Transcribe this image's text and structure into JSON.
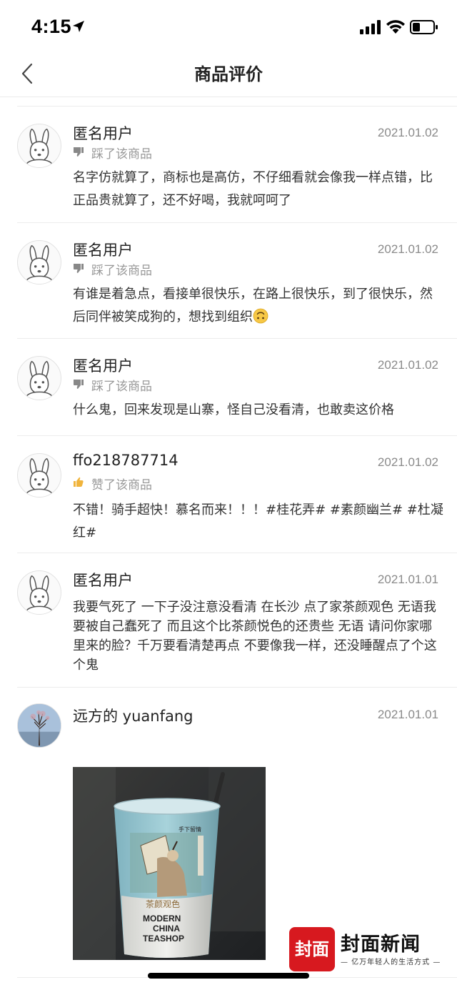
{
  "status_bar": {
    "time": "4:15"
  },
  "nav": {
    "title": "商品评价"
  },
  "reviews": [
    {
      "user": "匿名用户",
      "date": "2021.01.02",
      "rating_icon": "thumbs-down-icon",
      "rating_label": "踩了该商品",
      "content": "名字仿就算了，商标也是高仿，不仔细看就会像我一样点错，比正品贵就算了，还不好喝，我就呵呵了"
    },
    {
      "user": "匿名用户",
      "date": "2021.01.02",
      "rating_icon": "thumbs-down-icon",
      "rating_label": "踩了该商品",
      "content": "有谁是着急点，看接单很快乐，在路上很快乐，到了很快乐，然后同伴被笑成狗的，想找到组织"
    },
    {
      "user": "匿名用户",
      "date": "2021.01.02",
      "rating_icon": "thumbs-down-icon",
      "rating_label": "踩了该商品",
      "content": "什么鬼，回来发现是山寨，怪自己没看清，也敢卖这价格"
    },
    {
      "user": "ffo218787714",
      "date": "2021.01.02",
      "rating_icon": "thumbs-up-icon",
      "rating_label": "赞了该商品",
      "content": "不错！骑手超快！慕名而来！！！#桂花弄# #素颜幽兰# #杜凝红#"
    },
    {
      "user": "匿名用户",
      "date": "2021.01.01",
      "rating_icon": "",
      "rating_label": "",
      "content": "我要气死了 一下子没注意没看清 在长沙 点了家茶颜观色 无语我要被自己蠢死了 而且这个比茶颜悦色的还贵些 无语 请问你家哪里来的脸？千万要看清楚再点 不要像我一样，还没睡醒点了个这个鬼"
    },
    {
      "user": "远方的 yuanfang",
      "date": "2021.01.01",
      "rating_icon": "",
      "rating_label": "",
      "content": ""
    }
  ],
  "photo": {
    "cup_brand": "茶颜观色",
    "cup_text_line1": "MODERN",
    "cup_text_line2": "CHINA",
    "cup_text_line3": "TEASHOP"
  },
  "watermark": {
    "badge": "封面",
    "name": "封面新闻",
    "slogan": "— 亿万年轻人的生活方式 —"
  },
  "colors": {
    "accent_red": "#d7191f",
    "muted_text": "#999999",
    "thumbs_up": "#f0b43c"
  }
}
